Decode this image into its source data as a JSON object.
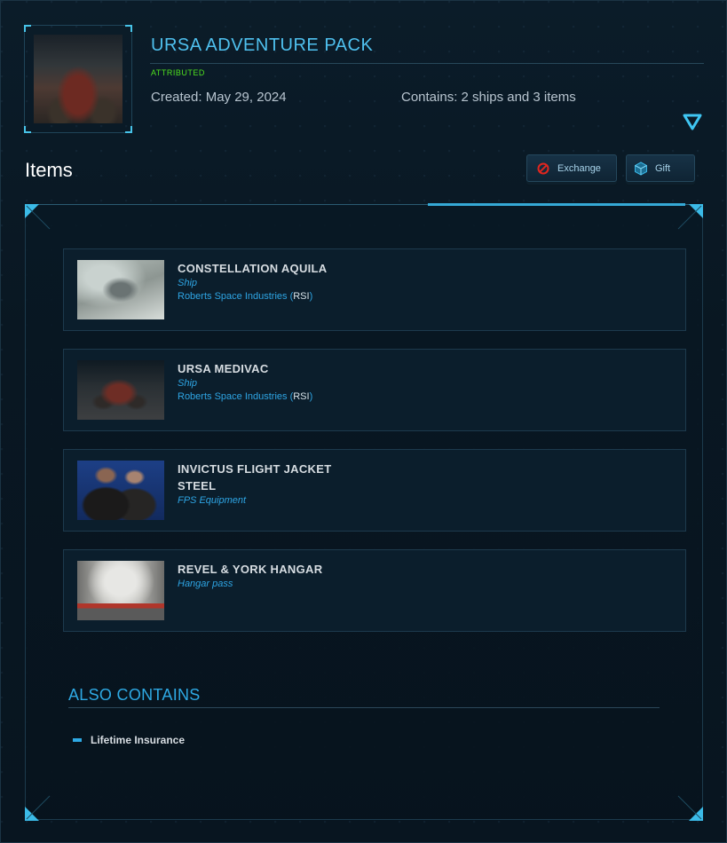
{
  "pack": {
    "title": "URSA ADVENTURE PACK",
    "status": "ATTRIBUTED",
    "created": "Created: May 29, 2024",
    "contains": "Contains: 2 ships and 3 items"
  },
  "items_section": {
    "heading": "Items",
    "exchange_label": "Exchange",
    "gift_label": "Gift"
  },
  "items": [
    {
      "name": "CONSTELLATION AQUILA",
      "type": "Ship",
      "manufacturer": "Roberts Space Industries (",
      "manufacturer_abbr": "RSI",
      "manufacturer_close": ")"
    },
    {
      "name": "URSA MEDIVAC",
      "type": "Ship",
      "manufacturer": "Roberts Space Industries (",
      "manufacturer_abbr": "RSI",
      "manufacturer_close": ")"
    },
    {
      "name": "INVICTUS FLIGHT JACKET STEEL",
      "type": "FPS Equipment"
    },
    {
      "name": "REVEL & YORK HANGAR",
      "type": "Hangar pass"
    }
  ],
  "also_contains": {
    "heading": "ALSO CONTAINS",
    "items": [
      "Lifetime Insurance"
    ]
  },
  "colors": {
    "accent": "#4fc1ef",
    "link": "#2ea5e4",
    "status_green": "#4ee11f",
    "exchange_icon": "#e0261f",
    "gift_icon": "#3ab7e6"
  },
  "icons": {
    "exchange": "forbidden-circle-icon",
    "gift": "cube-icon",
    "expand": "triangle-down-icon"
  }
}
